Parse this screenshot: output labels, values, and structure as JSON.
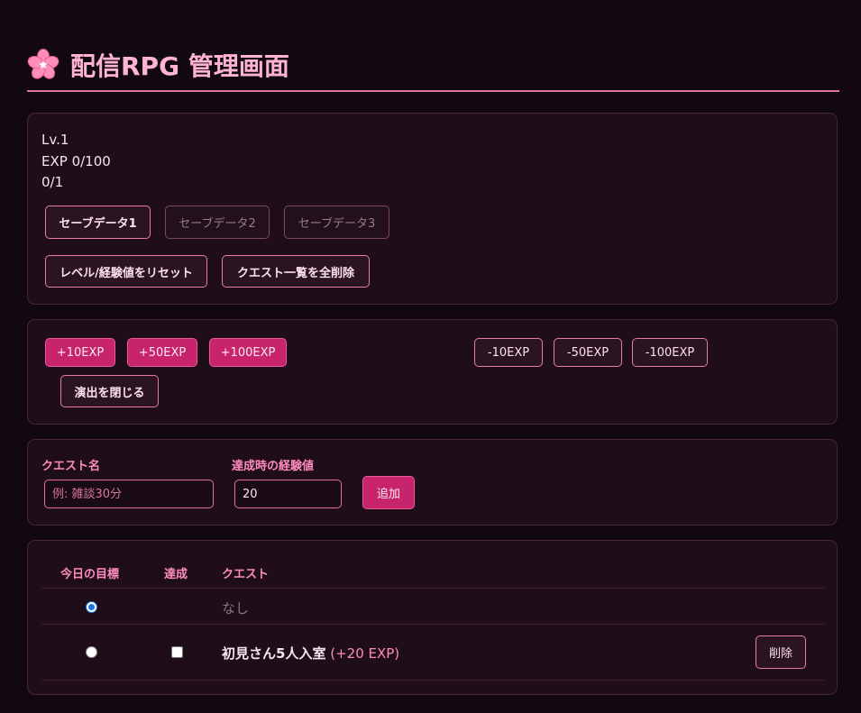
{
  "header": {
    "title": "配信RPG 管理画面",
    "icon": "cherry-blossom-icon"
  },
  "status": {
    "level": "Lv.1",
    "exp": "EXP 0/100",
    "progress": "0/1"
  },
  "save_slots": {
    "slot1": "セーブデータ1",
    "slot2": "セーブデータ2",
    "slot3": "セーブデータ3",
    "active": 1
  },
  "actions": {
    "reset": "レベル/経験値をリセット",
    "clear_quests": "クエスト一覧を全削除"
  },
  "exp_controls": {
    "plus10": "+10EXP",
    "plus50": "+50EXP",
    "plus100": "+100EXP",
    "minus10": "-10EXP",
    "minus50": "-50EXP",
    "minus100": "-100EXP",
    "close_effect": "演出を閉じる"
  },
  "quest_form": {
    "name_label": "クエスト名",
    "name_placeholder": "例: 雑談30分",
    "exp_label": "達成時の経験値",
    "exp_value": "20",
    "add_button": "追加"
  },
  "quest_table": {
    "headers": {
      "goal": "今日の目標",
      "done": "達成",
      "quest": "クエスト"
    },
    "rows": [
      {
        "name": "なし",
        "selected": true
      },
      {
        "name": "初見さん5人入室",
        "exp": "(+20 EXP)",
        "selected": false,
        "done": false,
        "delete_label": "削除"
      }
    ]
  },
  "colors": {
    "accent": "#c7246b",
    "title": "#ffb3d2",
    "label": "#ff8cbc",
    "background": "#120810",
    "panel": "#1f0e1a"
  }
}
